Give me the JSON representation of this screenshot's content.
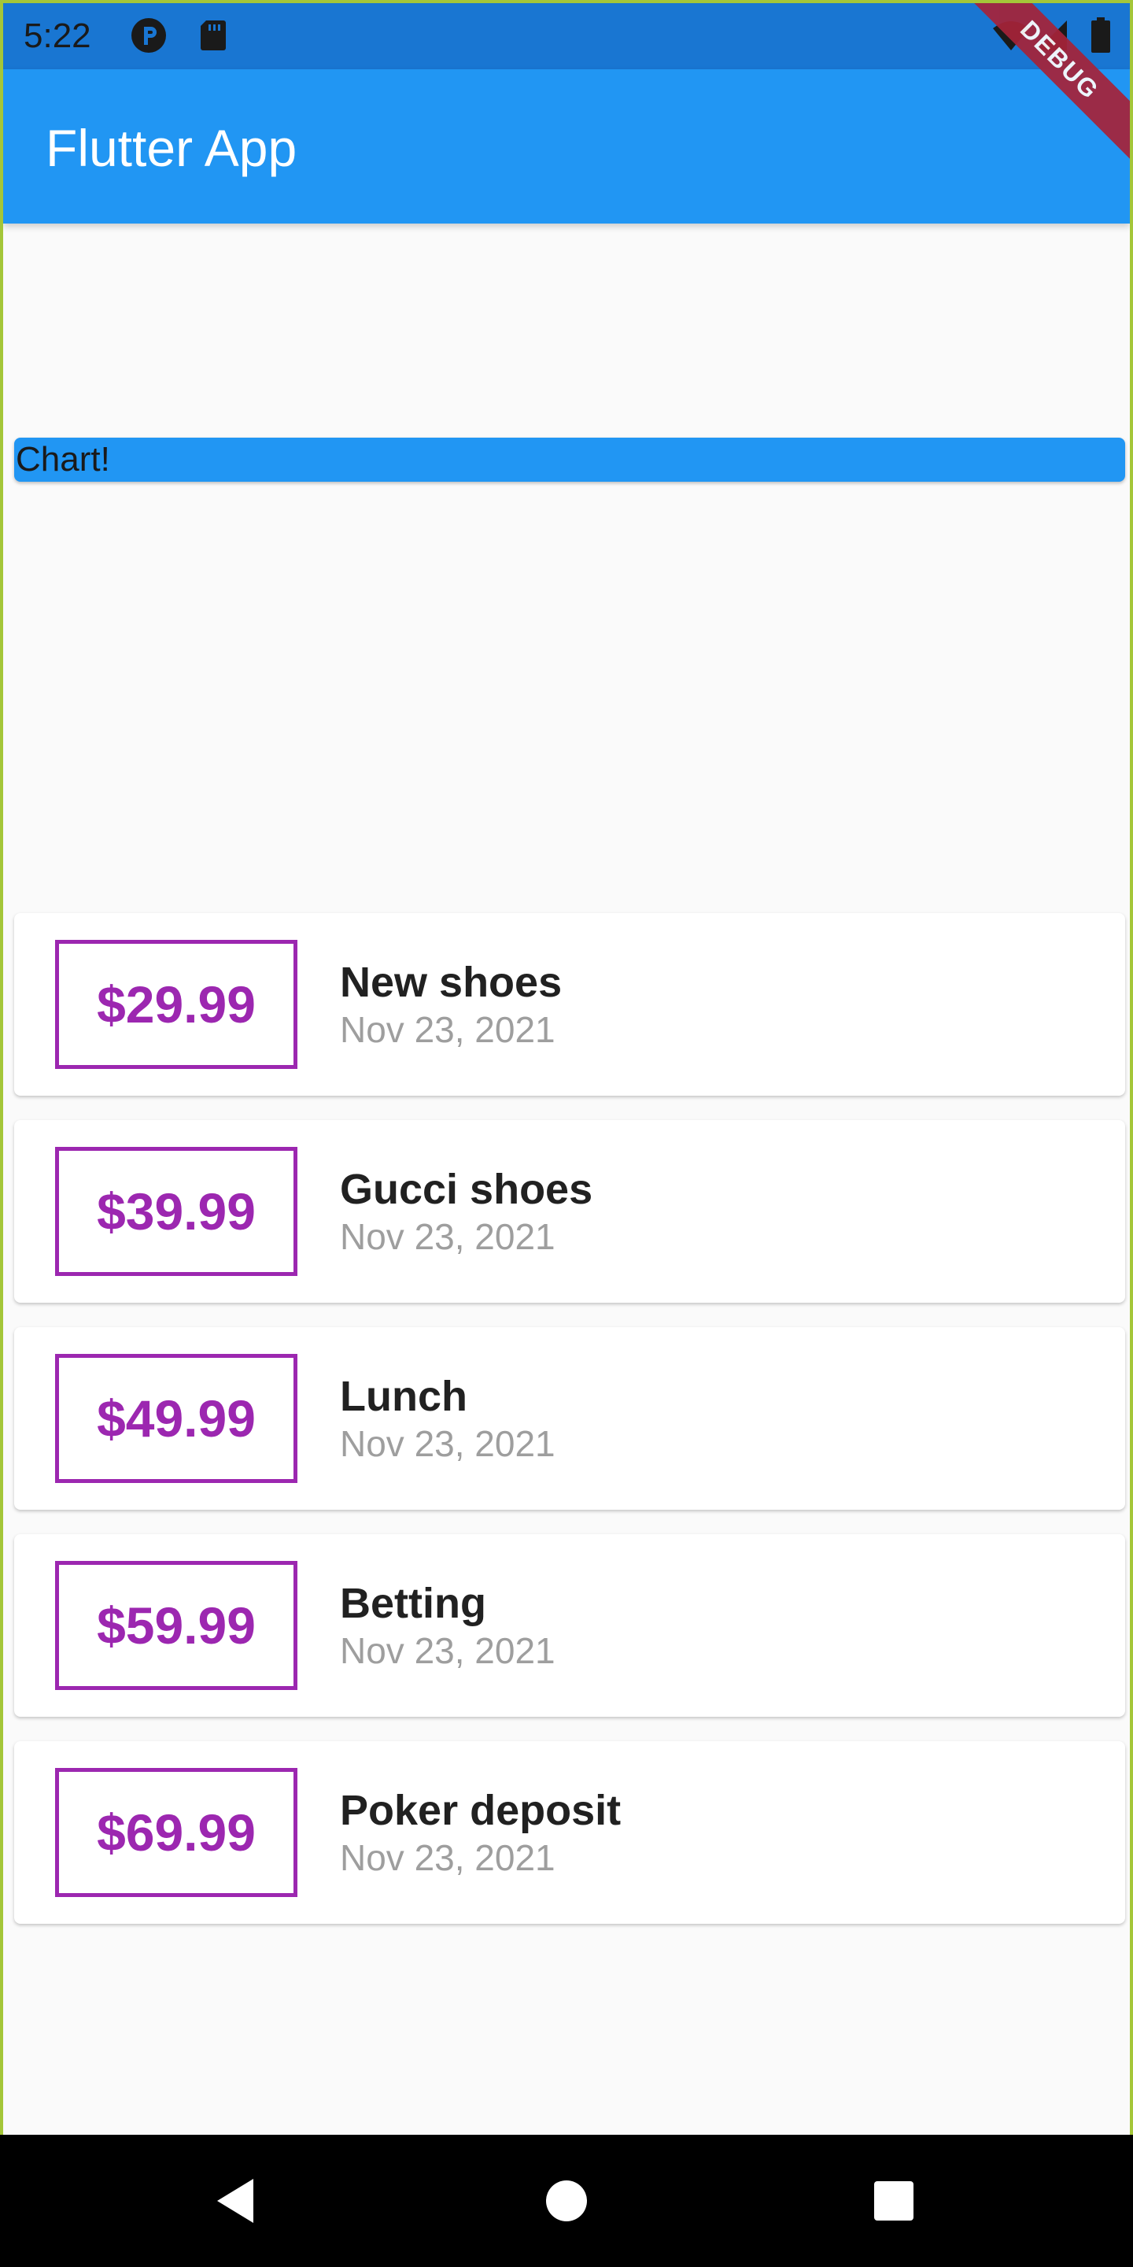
{
  "status_bar": {
    "time": "5:22",
    "left_icons": [
      "notification-p-icon",
      "sd-card-icon"
    ],
    "right_icons": [
      "wifi-icon",
      "signal-icon",
      "battery-icon"
    ]
  },
  "app_bar": {
    "title": "Flutter App"
  },
  "debug_banner": {
    "label": "DEBUG"
  },
  "chart": {
    "label": "Chart!"
  },
  "transactions": [
    {
      "amount": "$29.99",
      "title": "New shoes",
      "date": "Nov 23, 2021"
    },
    {
      "amount": "$39.99",
      "title": "Gucci shoes",
      "date": "Nov 23, 2021"
    },
    {
      "amount": "$49.99",
      "title": "Lunch",
      "date": "Nov 23, 2021"
    },
    {
      "amount": "$59.99",
      "title": "Betting",
      "date": "Nov 23, 2021"
    },
    {
      "amount": "$69.99",
      "title": "Poker deposit",
      "date": "Nov 23, 2021"
    }
  ],
  "nav_bar": {
    "buttons": [
      "back-icon",
      "home-icon",
      "recents-icon"
    ]
  },
  "colors": {
    "primary": "#2196f3",
    "status_bar": "#1976d2",
    "accent": "#9c27b0",
    "debug": "#a62339",
    "background": "#fafafa"
  }
}
